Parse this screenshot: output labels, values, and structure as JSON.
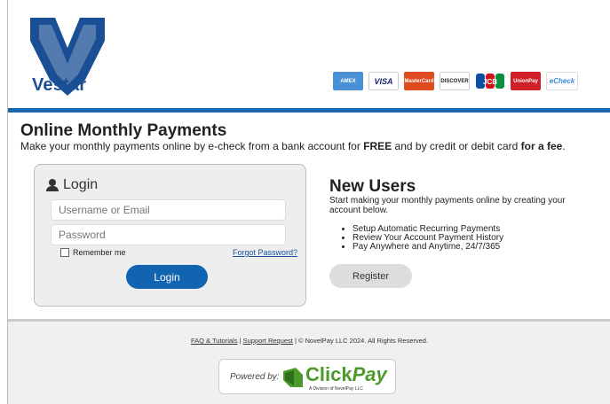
{
  "brand": {
    "name": "Vestar"
  },
  "cards": [
    {
      "label": "AMEX",
      "icon": "amex-card-icon"
    },
    {
      "label": "VISA",
      "icon": "visa-card-icon"
    },
    {
      "label": "MasterCard",
      "icon": "mastercard-icon"
    },
    {
      "label": "DISCOVER",
      "icon": "discover-card-icon"
    },
    {
      "label": "JCB",
      "icon": "jcb-card-icon"
    },
    {
      "label": "UnionPay",
      "icon": "unionpay-card-icon"
    },
    {
      "label": "eCheck",
      "icon": "echeck-icon"
    }
  ],
  "header": {
    "title": "Online Monthly Payments",
    "subtitle_pre": "Make your monthly payments online by e-check from a bank account for ",
    "subtitle_free": "FREE",
    "subtitle_mid": " and by credit or debit card ",
    "subtitle_fee": "for a fee",
    "subtitle_end": "."
  },
  "login": {
    "heading": "Login",
    "username_placeholder": "Username or Email",
    "password_placeholder": "Password",
    "remember_label": "Remember me",
    "forgot_label": "Forgot Password?",
    "button_label": "Login"
  },
  "new_users": {
    "title": "New Users",
    "description": "Start making your monthly payments online by creating your account below.",
    "features": [
      "Setup Automatic Recurring Payments",
      "Review Your Account Payment History",
      "Pay Anywhere and Anytime, 24/7/365"
    ],
    "register_label": "Register"
  },
  "footer": {
    "faq_label": "FAQ & Tutorials",
    "separator": " | ",
    "support_label": "Support Request",
    "copyright": " | © NovelPay LLC 2024. All Rights Reserved.",
    "powered_label": "Powered by:",
    "cp_click": "Click",
    "cp_pay": "Pay",
    "cp_division": "A Division of NovelPay LLC"
  },
  "colors": {
    "brand_blue": "#1b4f95",
    "accent_bar": "#1a66b0",
    "login_button": "#1264b1",
    "clickpay_green": "#4c9a2a"
  }
}
